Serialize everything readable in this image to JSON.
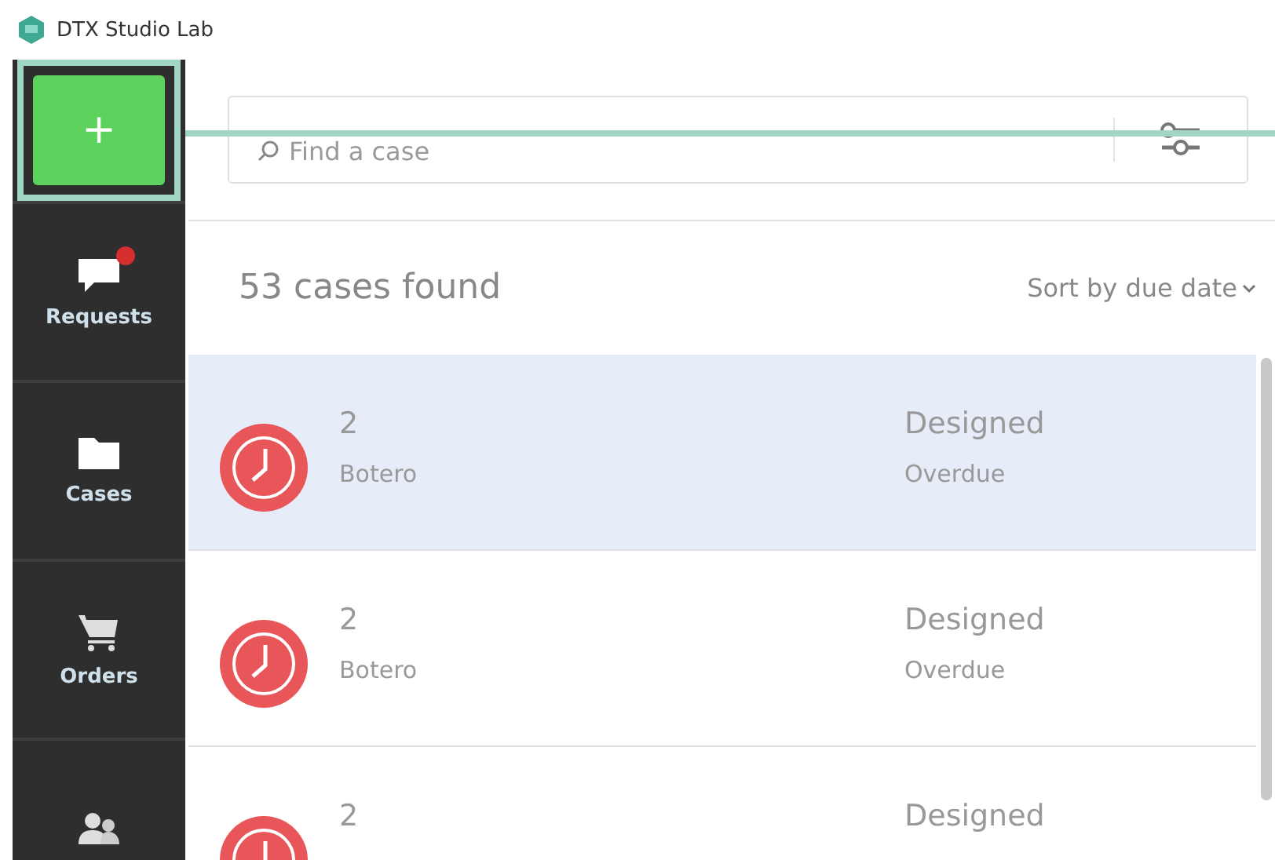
{
  "window": {
    "title": "DTX Studio Lab"
  },
  "new_button": {
    "label": "+",
    "highlighted": true
  },
  "sidebar": {
    "items": [
      {
        "kind": "requests",
        "label": "Requests",
        "badge": true
      },
      {
        "kind": "cases",
        "label": "Cases",
        "badge": false
      },
      {
        "kind": "orders",
        "label": "Orders",
        "badge": false
      },
      {
        "kind": "contacts",
        "badge": false
      }
    ]
  },
  "search": {
    "placeholder": "Find a case"
  },
  "results": {
    "count": "53 cases found",
    "sort": "Sort by due date"
  },
  "cases": [
    {
      "number": "2",
      "name": "Botero",
      "status": "Designed",
      "due": "Overdue",
      "selected": true
    },
    {
      "number": "2",
      "name": "Botero",
      "status": "Designed",
      "due": "Overdue",
      "selected": false
    },
    {
      "number": "2",
      "status": "Designed",
      "selected": false
    }
  ]
}
